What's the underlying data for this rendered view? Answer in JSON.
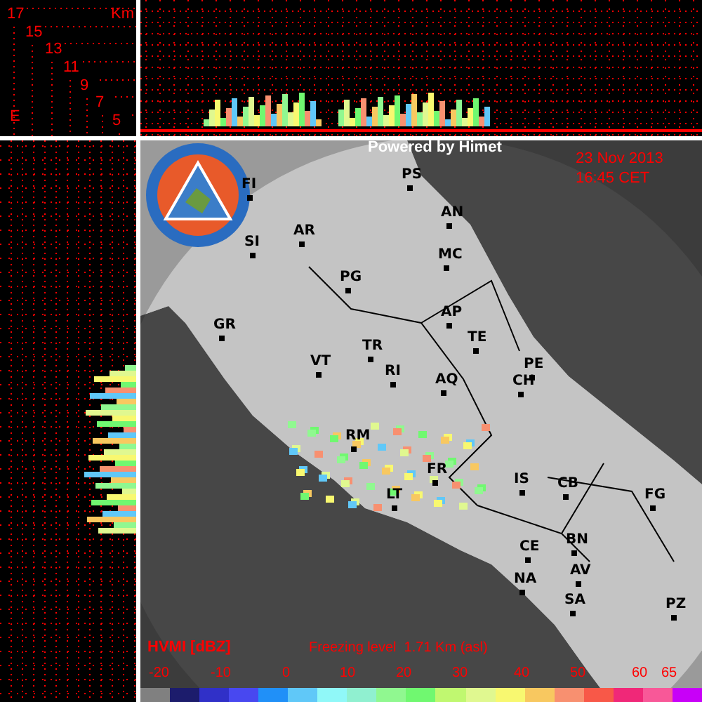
{
  "height_axis": {
    "unit": "Km",
    "labels": [
      "17",
      "15",
      "13",
      "11",
      "9",
      "7",
      "5"
    ],
    "corner_mark": "E"
  },
  "map": {
    "credit": "Powered by Himet",
    "date": "23 Nov 2013",
    "time": "16:45 CET",
    "cities": [
      "FI",
      "SI",
      "AR",
      "PG",
      "GR",
      "TR",
      "VT",
      "RI",
      "AQ",
      "PS",
      "AN",
      "MC",
      "AP",
      "TE",
      "PE",
      "CH",
      "RM",
      "FR",
      "LT",
      "IS",
      "CB",
      "FG",
      "CE",
      "BN",
      "AV",
      "NA",
      "SA",
      "PZ"
    ]
  },
  "legend": {
    "title": "HVMI [dBZ]",
    "freezing_level": "Freezing level  1.71 Km (asl)",
    "ticks": [
      "-20",
      "-10",
      "0",
      "10",
      "20",
      "30",
      "40",
      "50",
      "60",
      "65"
    ],
    "swatches": [
      {
        "color": "#808080"
      },
      {
        "color": "#1c1c6c"
      },
      {
        "color": "#3030c8"
      },
      {
        "color": "#4848f0"
      },
      {
        "color": "#2090f8"
      },
      {
        "color": "#60c8f8"
      },
      {
        "color": "#90f8f8"
      },
      {
        "color": "#90f0d0"
      },
      {
        "color": "#90f890"
      },
      {
        "color": "#70f870"
      },
      {
        "color": "#c0f870"
      },
      {
        "color": "#e0f890"
      },
      {
        "color": "#f8f870"
      },
      {
        "color": "#f8c860"
      },
      {
        "color": "#f89070"
      },
      {
        "color": "#f85848"
      },
      {
        "color": "#f02878"
      },
      {
        "color": "#f85898"
      },
      {
        "color": "#c800f8"
      }
    ]
  }
}
